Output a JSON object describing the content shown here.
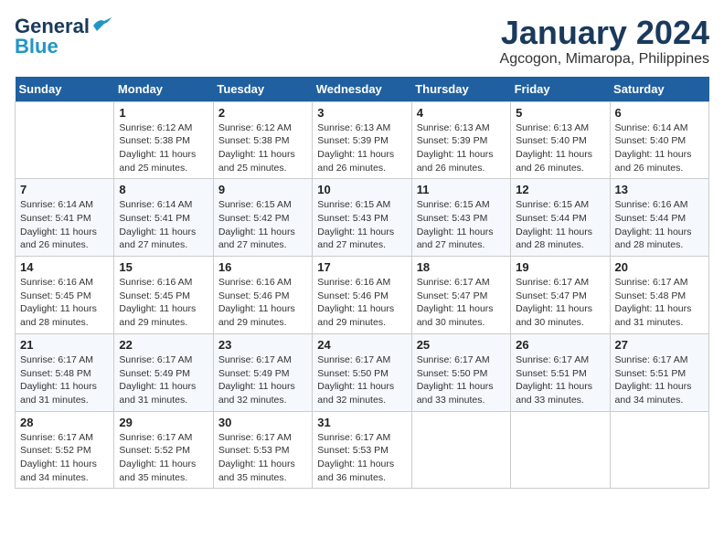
{
  "logo": {
    "general": "General",
    "blue": "Blue"
  },
  "header": {
    "title": "January 2024",
    "subtitle": "Agcogon, Mimaropa, Philippines"
  },
  "weekdays": [
    "Sunday",
    "Monday",
    "Tuesday",
    "Wednesday",
    "Thursday",
    "Friday",
    "Saturday"
  ],
  "weeks": [
    [
      {
        "day": "",
        "info": ""
      },
      {
        "day": "1",
        "info": "Sunrise: 6:12 AM\nSunset: 5:38 PM\nDaylight: 11 hours\nand 25 minutes."
      },
      {
        "day": "2",
        "info": "Sunrise: 6:12 AM\nSunset: 5:38 PM\nDaylight: 11 hours\nand 25 minutes."
      },
      {
        "day": "3",
        "info": "Sunrise: 6:13 AM\nSunset: 5:39 PM\nDaylight: 11 hours\nand 26 minutes."
      },
      {
        "day": "4",
        "info": "Sunrise: 6:13 AM\nSunset: 5:39 PM\nDaylight: 11 hours\nand 26 minutes."
      },
      {
        "day": "5",
        "info": "Sunrise: 6:13 AM\nSunset: 5:40 PM\nDaylight: 11 hours\nand 26 minutes."
      },
      {
        "day": "6",
        "info": "Sunrise: 6:14 AM\nSunset: 5:40 PM\nDaylight: 11 hours\nand 26 minutes."
      }
    ],
    [
      {
        "day": "7",
        "info": "Sunrise: 6:14 AM\nSunset: 5:41 PM\nDaylight: 11 hours\nand 26 minutes."
      },
      {
        "day": "8",
        "info": "Sunrise: 6:14 AM\nSunset: 5:41 PM\nDaylight: 11 hours\nand 27 minutes."
      },
      {
        "day": "9",
        "info": "Sunrise: 6:15 AM\nSunset: 5:42 PM\nDaylight: 11 hours\nand 27 minutes."
      },
      {
        "day": "10",
        "info": "Sunrise: 6:15 AM\nSunset: 5:43 PM\nDaylight: 11 hours\nand 27 minutes."
      },
      {
        "day": "11",
        "info": "Sunrise: 6:15 AM\nSunset: 5:43 PM\nDaylight: 11 hours\nand 27 minutes."
      },
      {
        "day": "12",
        "info": "Sunrise: 6:15 AM\nSunset: 5:44 PM\nDaylight: 11 hours\nand 28 minutes."
      },
      {
        "day": "13",
        "info": "Sunrise: 6:16 AM\nSunset: 5:44 PM\nDaylight: 11 hours\nand 28 minutes."
      }
    ],
    [
      {
        "day": "14",
        "info": "Sunrise: 6:16 AM\nSunset: 5:45 PM\nDaylight: 11 hours\nand 28 minutes."
      },
      {
        "day": "15",
        "info": "Sunrise: 6:16 AM\nSunset: 5:45 PM\nDaylight: 11 hours\nand 29 minutes."
      },
      {
        "day": "16",
        "info": "Sunrise: 6:16 AM\nSunset: 5:46 PM\nDaylight: 11 hours\nand 29 minutes."
      },
      {
        "day": "17",
        "info": "Sunrise: 6:16 AM\nSunset: 5:46 PM\nDaylight: 11 hours\nand 29 minutes."
      },
      {
        "day": "18",
        "info": "Sunrise: 6:17 AM\nSunset: 5:47 PM\nDaylight: 11 hours\nand 30 minutes."
      },
      {
        "day": "19",
        "info": "Sunrise: 6:17 AM\nSunset: 5:47 PM\nDaylight: 11 hours\nand 30 minutes."
      },
      {
        "day": "20",
        "info": "Sunrise: 6:17 AM\nSunset: 5:48 PM\nDaylight: 11 hours\nand 31 minutes."
      }
    ],
    [
      {
        "day": "21",
        "info": "Sunrise: 6:17 AM\nSunset: 5:48 PM\nDaylight: 11 hours\nand 31 minutes."
      },
      {
        "day": "22",
        "info": "Sunrise: 6:17 AM\nSunset: 5:49 PM\nDaylight: 11 hours\nand 31 minutes."
      },
      {
        "day": "23",
        "info": "Sunrise: 6:17 AM\nSunset: 5:49 PM\nDaylight: 11 hours\nand 32 minutes."
      },
      {
        "day": "24",
        "info": "Sunrise: 6:17 AM\nSunset: 5:50 PM\nDaylight: 11 hours\nand 32 minutes."
      },
      {
        "day": "25",
        "info": "Sunrise: 6:17 AM\nSunset: 5:50 PM\nDaylight: 11 hours\nand 33 minutes."
      },
      {
        "day": "26",
        "info": "Sunrise: 6:17 AM\nSunset: 5:51 PM\nDaylight: 11 hours\nand 33 minutes."
      },
      {
        "day": "27",
        "info": "Sunrise: 6:17 AM\nSunset: 5:51 PM\nDaylight: 11 hours\nand 34 minutes."
      }
    ],
    [
      {
        "day": "28",
        "info": "Sunrise: 6:17 AM\nSunset: 5:52 PM\nDaylight: 11 hours\nand 34 minutes."
      },
      {
        "day": "29",
        "info": "Sunrise: 6:17 AM\nSunset: 5:52 PM\nDaylight: 11 hours\nand 35 minutes."
      },
      {
        "day": "30",
        "info": "Sunrise: 6:17 AM\nSunset: 5:53 PM\nDaylight: 11 hours\nand 35 minutes."
      },
      {
        "day": "31",
        "info": "Sunrise: 6:17 AM\nSunset: 5:53 PM\nDaylight: 11 hours\nand 36 minutes."
      },
      {
        "day": "",
        "info": ""
      },
      {
        "day": "",
        "info": ""
      },
      {
        "day": "",
        "info": ""
      }
    ]
  ]
}
